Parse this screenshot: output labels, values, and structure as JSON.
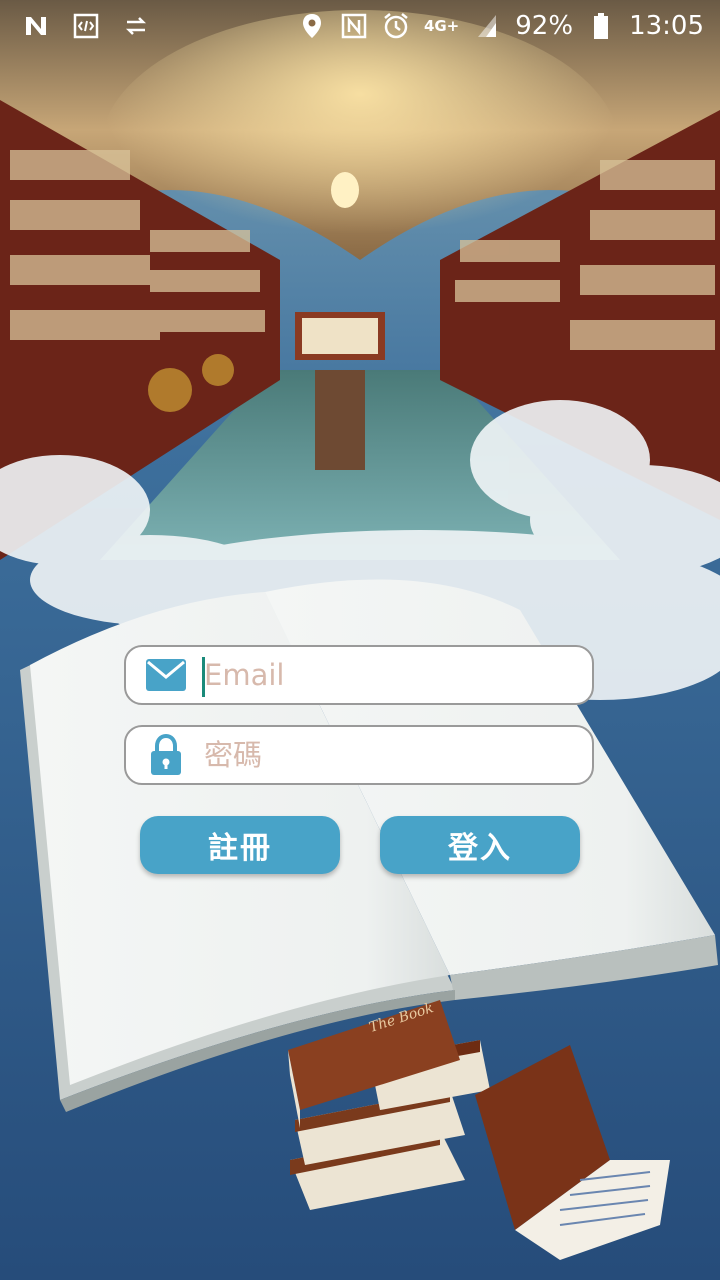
{
  "status_bar": {
    "time": "13:05",
    "battery": "92%",
    "network": "4G+",
    "left_icons": [
      "n-icon",
      "code-icon",
      "sync-icon"
    ],
    "right_icons": [
      "location-icon",
      "nfc-icon",
      "alarm-icon",
      "signal-icon",
      "battery-icon"
    ]
  },
  "login": {
    "email_placeholder": "Email",
    "email_value": "",
    "password_placeholder": "密碼",
    "password_value": "",
    "register_label": "註冊",
    "login_label": "登入"
  },
  "illustration": {
    "book_title": "The Book"
  },
  "colors": {
    "button": "#48a3c8",
    "icon": "#48a3c8",
    "placeholder": "#d7b9ac"
  }
}
